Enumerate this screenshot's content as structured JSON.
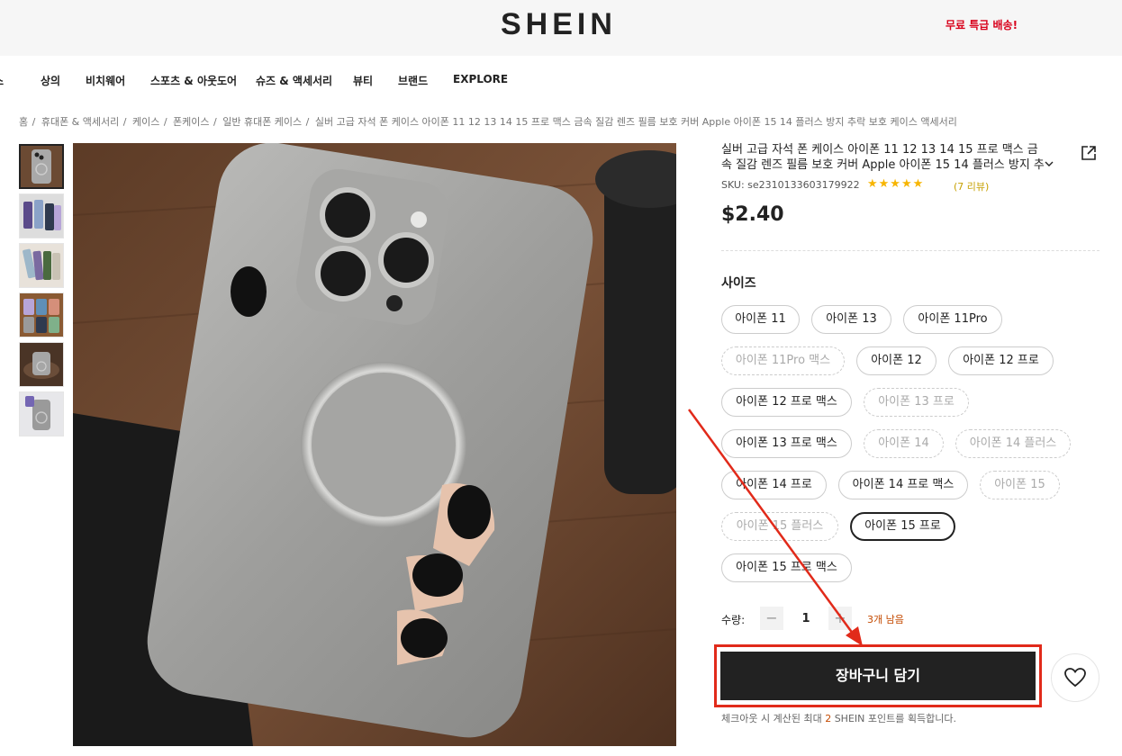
{
  "header": {
    "logo": "SHEIN",
    "promo": "무료 특급 배송!"
  },
  "nav": {
    "items": [
      "스",
      "상의",
      "비치웨어",
      "스포츠 & 아웃도어",
      "슈즈 & 액세서리",
      "뷰티",
      "브랜드",
      "EXPLORE"
    ]
  },
  "breadcrumb": {
    "items": [
      "홈",
      "휴대폰 & 액세서리",
      "케이스",
      "폰케이스",
      "일반 휴대폰 케이스"
    ],
    "current": "실버 고급 자석 폰 케이스 아이폰 11 12 13 14 15 프로 맥스 금속 질감 렌즈 필름 보호 커버 Apple 아이폰 15 14 플러스 방지 추락 보호 케이스 액세서리"
  },
  "product": {
    "title": "실버 고급 자석 폰 케이스 아이폰 11 12 13 14 15 프로 맥스 금속 질감 렌즈 필름 보호 커버 Apple 아이폰 15 14 플러스 방지 추락 보호 케이스 액세서리",
    "sku": "SKU: se2310133603179922",
    "stars": "★★★★★",
    "reviews": "(7 리뷰)",
    "price": "$2.40",
    "size_label": "사이즈",
    "sizes": [
      "아이폰 11",
      "아이폰 13",
      "아이폰 11Pro",
      "아이폰 11Pro 맥스",
      "아이폰 12",
      "아이폰 12 프로",
      "아이폰 12 프로 맥스",
      "아이폰 13 프로",
      "아이폰 13 프로 맥스",
      "아이폰 14",
      "아이폰 14 플러스",
      "아이폰 14 프로",
      "아이폰 14 프로 맥스",
      "아이폰 15",
      "아이폰 15 플러스",
      "아이폰 15 프로",
      "아이폰 15 프로 맥스"
    ],
    "disabled_sizes": [
      "아이폰 11Pro 맥스",
      "아이폰 13 프로",
      "아이폰 14",
      "아이폰 14 플러스",
      "아이폰 15",
      "아이폰 15 플러스"
    ],
    "selected_size": "아이폰 15 프로",
    "quantity_label": "수량:",
    "quantity": "1",
    "minus": "−",
    "plus": "+",
    "stock": "3개 남음",
    "add_to_cart": "장바구니 담기",
    "points_prefix": "체크아웃 시 계산된 최대",
    "points_value": "2",
    "points_suffix": "SHEIN 포인트를 획득합니다."
  },
  "colors": {
    "accent": "#222222",
    "highlight": "#e12a1a",
    "star": "#f7b500",
    "promo": "#d8001b"
  },
  "icons": [
    "share-icon",
    "chevron-down-icon",
    "heart-icon",
    "star-icon"
  ]
}
